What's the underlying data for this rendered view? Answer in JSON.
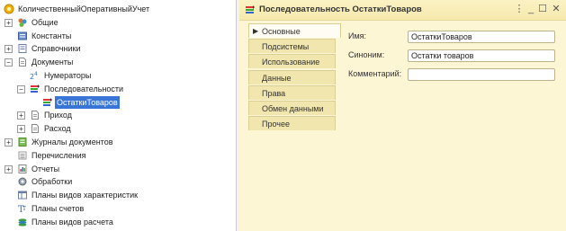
{
  "tree": {
    "nodes": [
      {
        "label": "КоличественныйОперативныйУчет",
        "icon": "config-root-icon",
        "expander": "",
        "selected": false
      },
      {
        "label": "Общие",
        "icon": "common-icon",
        "expander": "+",
        "selected": false
      },
      {
        "label": "Константы",
        "icon": "constants-icon",
        "expander": "",
        "selected": false
      },
      {
        "label": "Справочники",
        "icon": "catalogs-icon",
        "expander": "+",
        "selected": false
      },
      {
        "label": "Документы",
        "icon": "documents-icon",
        "expander": "−",
        "selected": false
      },
      {
        "label": "Нумераторы",
        "icon": "numerators-icon",
        "expander": "",
        "selected": false
      },
      {
        "label": "Последовательности",
        "icon": "sequences-icon",
        "expander": "−",
        "selected": false
      },
      {
        "label": "ОстаткиТоваров",
        "icon": "sequence-icon",
        "expander": "",
        "selected": true
      },
      {
        "label": "Приход",
        "icon": "document-icon",
        "expander": "+",
        "selected": false
      },
      {
        "label": "Расход",
        "icon": "document-icon",
        "expander": "+",
        "selected": false
      },
      {
        "label": "Журналы документов",
        "icon": "journals-icon",
        "expander": "+",
        "selected": false
      },
      {
        "label": "Перечисления",
        "icon": "enums-icon",
        "expander": "",
        "selected": false
      },
      {
        "label": "Отчеты",
        "icon": "reports-icon",
        "expander": "+",
        "selected": false
      },
      {
        "label": "Обработки",
        "icon": "data-processors-icon",
        "expander": "",
        "selected": false
      },
      {
        "label": "Планы видов характеристик",
        "icon": "chart-of-characteristics-icon",
        "expander": "",
        "selected": false
      },
      {
        "label": "Планы счетов",
        "icon": "chart-of-accounts-icon",
        "expander": "",
        "selected": false
      },
      {
        "label": "Планы видов расчета",
        "icon": "chart-of-calculation-icon",
        "expander": "",
        "selected": false
      }
    ]
  },
  "window": {
    "title": "Последовательность ОстаткиТоваров",
    "buttons": {
      "menu": "⋮",
      "minimize": "_",
      "maximize": "☐",
      "close": "✕"
    }
  },
  "tabs": [
    {
      "label": "Основные",
      "active": true
    },
    {
      "label": "Подсистемы",
      "active": false
    },
    {
      "label": "Использование",
      "active": false
    },
    {
      "label": "Данные",
      "active": false
    },
    {
      "label": "Права",
      "active": false
    },
    {
      "label": "Обмен данными",
      "active": false
    },
    {
      "label": "Прочее",
      "active": false
    }
  ],
  "form": {
    "name_label": "Имя:",
    "name_value": "ОстаткиТоваров",
    "synonym_label": "Синоним:",
    "synonym_value": "Остатки товаров",
    "comment_label": "Комментарий:",
    "comment_value": ""
  },
  "colors": {
    "panel_background": "#fdf6d4",
    "selection": "#3875d7"
  }
}
